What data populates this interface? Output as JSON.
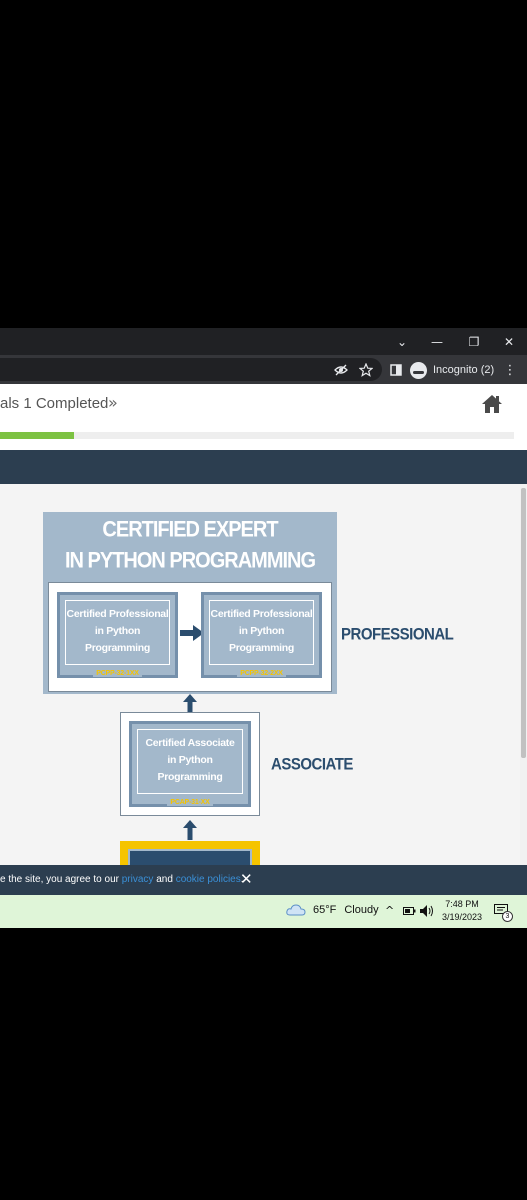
{
  "browser": {
    "window_controls": {
      "tabs_dropdown": "⌄",
      "minimize": "—",
      "restore": "❐",
      "close": "✕"
    },
    "toolbar": {
      "eye_slash_icon": "eye-slash",
      "bookmark_icon": "star",
      "sidepanel_icon": "side-panel",
      "profile_label": "Incognito (2)",
      "menu_icon": "⋮"
    }
  },
  "page": {
    "header": {
      "status_text": "als 1 Completed",
      "status_chevron": "»",
      "progress_percent": 14.3
    },
    "diagram": {
      "expert_title_line1": "CERTIFIED EXPERT",
      "expert_title_line2": "IN PYTHON PROGRAMMING",
      "professional": {
        "label": "PROFESSIONAL",
        "cert1": {
          "line1": "Certified Professional",
          "line2": "in Python",
          "line3": "Programming",
          "code": "PCPP-32-1XX"
        },
        "cert2": {
          "line1": "Certified Professional",
          "line2": "in Python",
          "line3": "Programming",
          "code": "PCPP-32-2XX"
        }
      },
      "associate": {
        "label": "ASSOCIATE",
        "cert": {
          "line1": "Certified Associate",
          "line2": "in Python",
          "line3": "Programming",
          "code": "PCAP-31-XX"
        }
      }
    },
    "cookie_bar": {
      "text_before": "e the site, you agree to our ",
      "privacy_link": "privacy",
      "text_middle": " and ",
      "cookie_link": "cookie policies",
      "text_after": ".",
      "close": "✕"
    }
  },
  "taskbar": {
    "weather_temp": "65°F",
    "weather_desc": "Cloudy",
    "tray_chevron": "^",
    "time": "7:48 PM",
    "date": "3/19/2023",
    "notification_count": "3"
  },
  "colors": {
    "titlebar": "#202124",
    "toolbar": "#35363a",
    "progress": "#7dc242",
    "dark_band": "#2c3e50",
    "cert_light": "#a3b8cb",
    "cert_dark": "#7590ab",
    "label_blue": "#2b4d6e",
    "code_yellow": "#f5c400",
    "taskbar": "#dff5d8"
  }
}
